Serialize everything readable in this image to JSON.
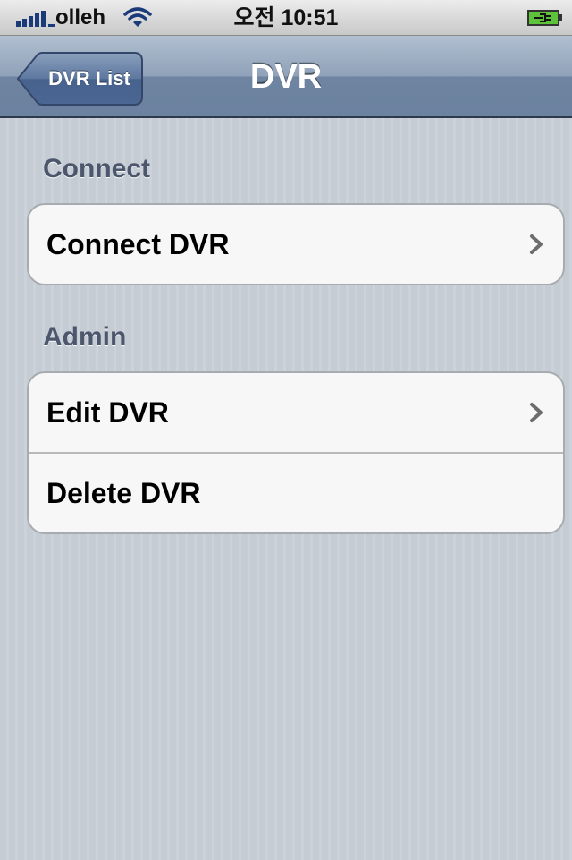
{
  "status_bar": {
    "carrier": "olleh",
    "time": "오전 10:51",
    "icons": [
      "signal-icon",
      "wifi-icon",
      "battery-charging-icon"
    ]
  },
  "nav_bar": {
    "back_label": "DVR List",
    "title": "DVR"
  },
  "sections": [
    {
      "header": "Connect",
      "rows": [
        {
          "label": "Connect DVR",
          "disclosure": true
        }
      ]
    },
    {
      "header": "Admin",
      "rows": [
        {
          "label": "Edit DVR",
          "disclosure": true
        },
        {
          "label": "Delete DVR",
          "disclosure": false
        }
      ]
    }
  ],
  "colors": {
    "nav_bar": "#6d84a2",
    "background": "#c5ccd4",
    "section_header": "#4c566c",
    "cell_background": "#f7f7f7"
  }
}
